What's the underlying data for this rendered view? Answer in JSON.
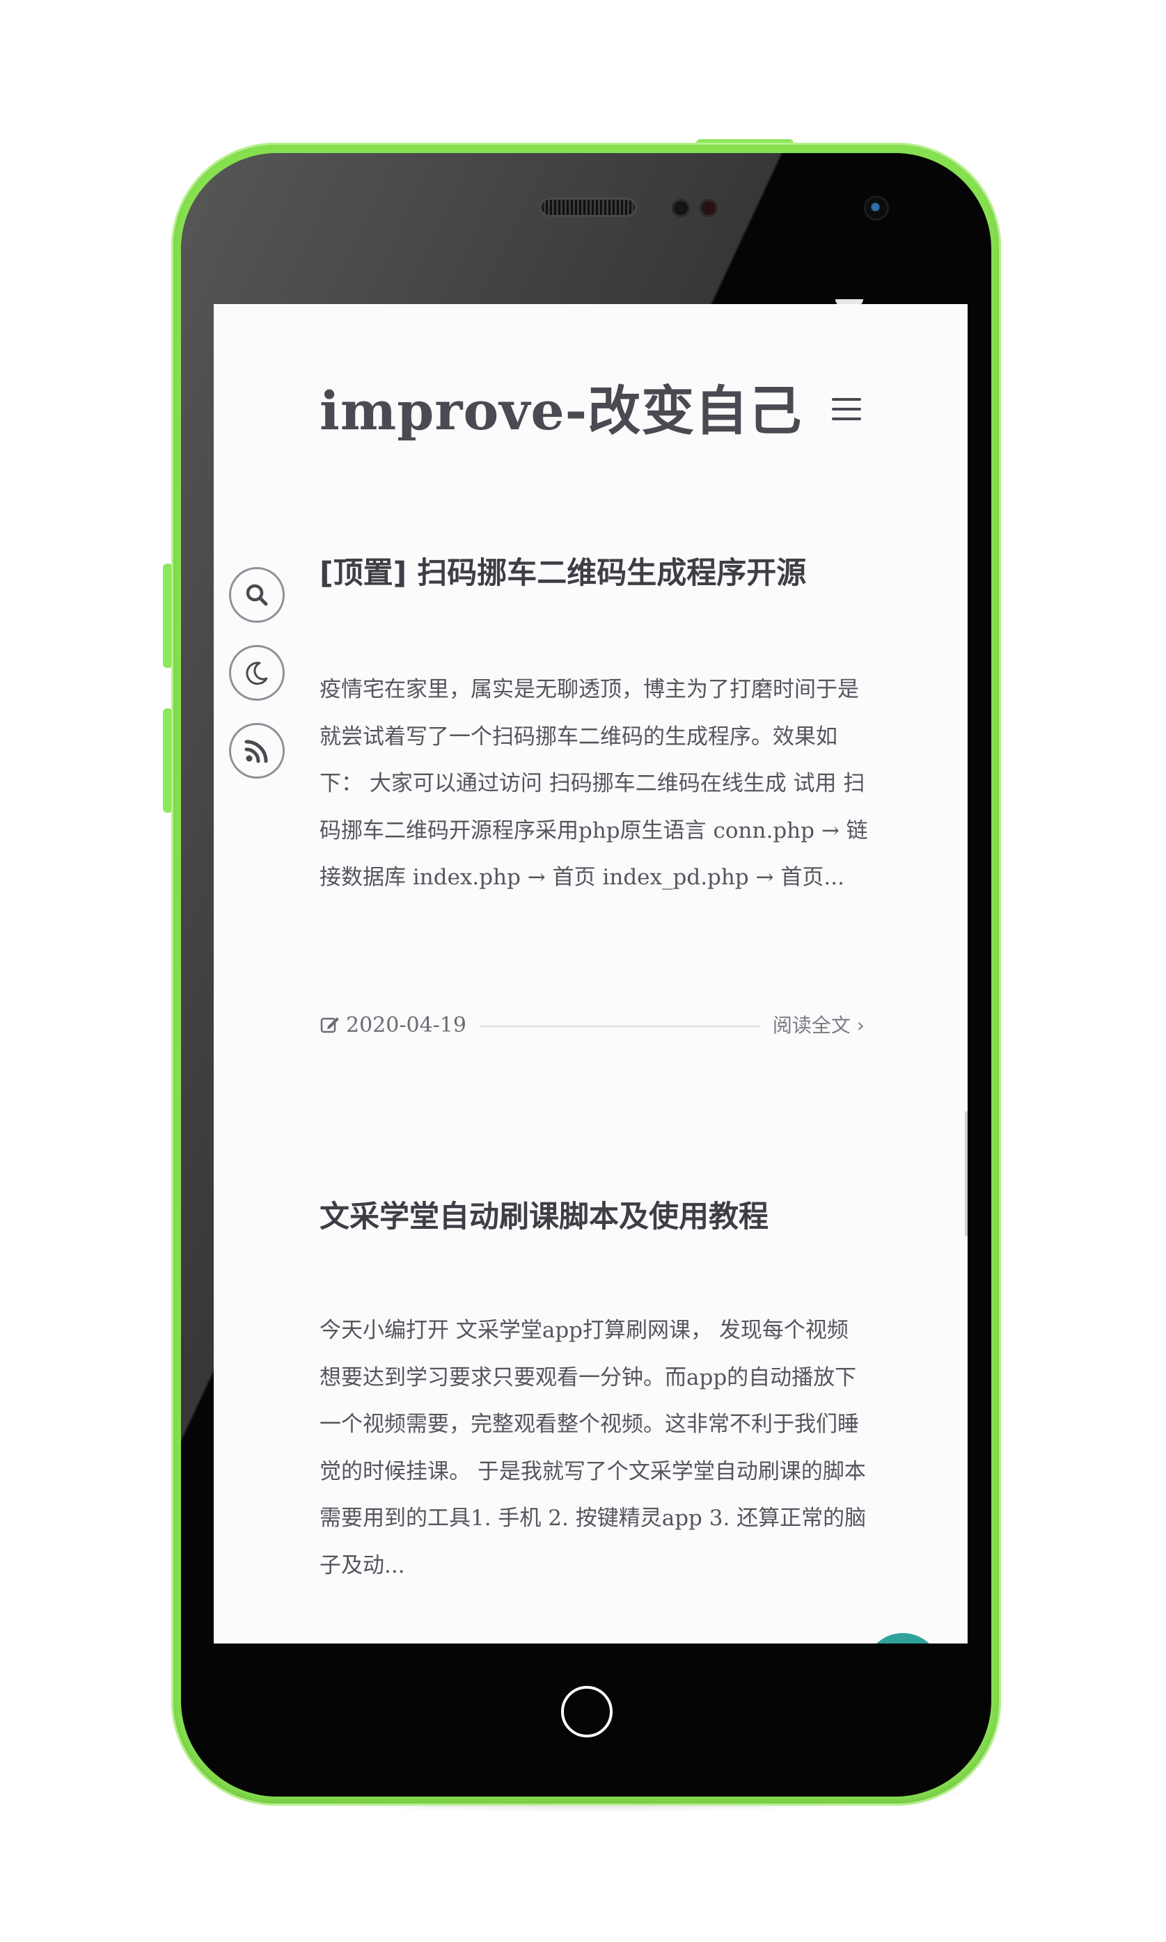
{
  "header": {
    "site_title": "improve-改变自己",
    "menu_icon": "hamburger-menu-icon"
  },
  "floating_buttons": [
    {
      "icon": "search-icon"
    },
    {
      "icon": "moon-icon"
    },
    {
      "icon": "rss-icon"
    }
  ],
  "posts": [
    {
      "title": "[顶置] 扫码挪车二维码生成程序开源",
      "excerpt": "疫情宅在家里，属实是无聊透顶，博主为了打磨时间于是就尝试着写了一个扫码挪车二维码的生成程序。效果如下： 大家可以通过访问 扫码挪车二维码在线生成 试用 扫码挪车二维码开源程序采用php原生语言 conn.php → 链接数据库 index.php → 首页 index_pd.php → 首页...",
      "date": "2020-04-19",
      "date_icon": "edit-icon",
      "read_more": "阅读全文 ›"
    },
    {
      "title": "文采学堂自动刷课脚本及使用教程",
      "excerpt": "今天小编打开 文采学堂app打算刷网课， 发现每个视频想要达到学习要求只要观看一分钟。而app的自动播放下一个视频需要，完整观看整个视频。这非常不利于我们睡觉的时候挂课。 于是我就写了个文采学堂自动刷课的脚本 需要用到的工具1. 手机 2. 按键精灵app 3. 还算正常的脑子及动..."
    }
  ],
  "colors": {
    "phone_body": "#86e04f",
    "screen_bg": "#fbfbfc",
    "title_text": "#4a4a52",
    "fab": "#2fa39a"
  }
}
